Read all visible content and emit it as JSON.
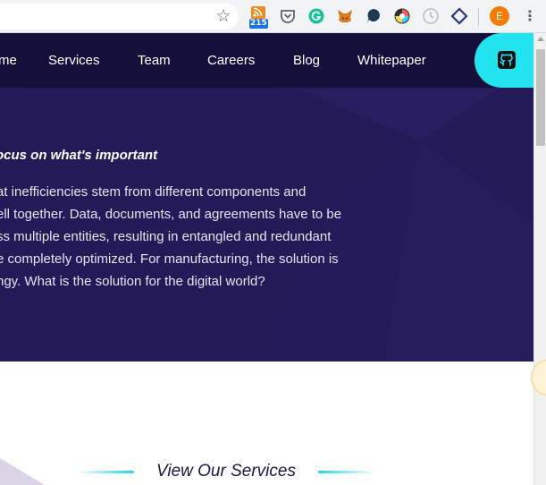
{
  "browser": {
    "star_glyph": "☆",
    "rss_badge": "215",
    "profile_initial": "E",
    "menu_glyph": "⋮",
    "extensions": [
      "rss-feed-icon",
      "pocket-icon",
      "grammarly-icon",
      "metamask-icon",
      "speech-bubble-icon",
      "color-wheel-icon",
      "clock-icon",
      "diamond-icon"
    ]
  },
  "nav": {
    "items": [
      {
        "label": "me"
      },
      {
        "label": "Services"
      },
      {
        "label": "Team"
      },
      {
        "label": "Careers"
      },
      {
        "label": "Blog"
      },
      {
        "label": "Whitepaper"
      }
    ],
    "github_icon": "github-icon"
  },
  "hero": {
    "heading": "ocus on what's important",
    "lines": [
      "at inefficiencies stem from different components and",
      "ell together. Data, documents, and agreements have to be",
      "ss multiple entities, resulting in entangled and redundant",
      "e completely optimized. For manufacturing, the solution is",
      "ngy. What is the solution for the digital world?"
    ]
  },
  "services": {
    "title": "View Our Services"
  },
  "colors": {
    "nav_bg": "#150f3c",
    "hero_bg": "#241a58",
    "accent": "#22e4f0"
  }
}
